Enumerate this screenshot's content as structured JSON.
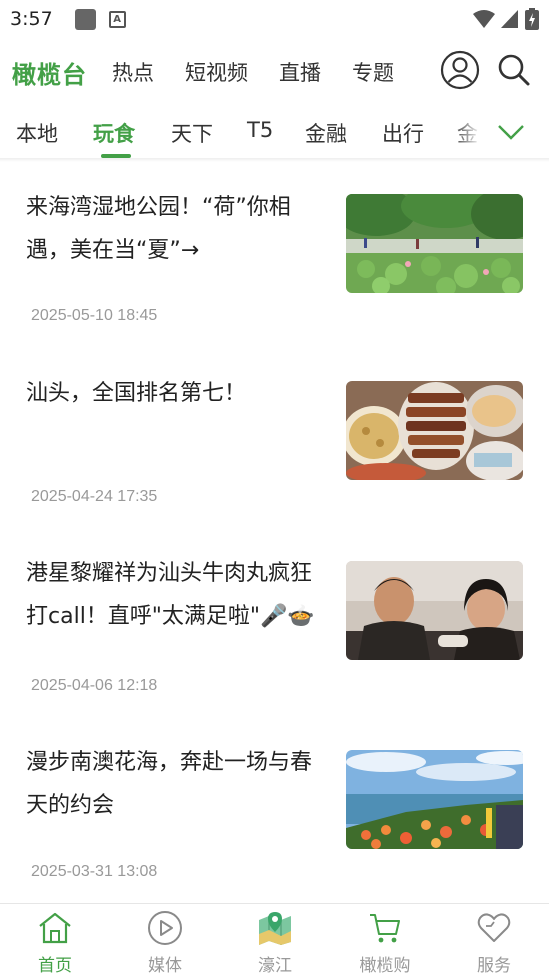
{
  "status_bar": {
    "time": "3:57"
  },
  "header": {
    "logo": "橄榄台",
    "nav": [
      "热点",
      "短视频",
      "直播",
      "专题"
    ]
  },
  "categories": {
    "items": [
      "本地",
      "玩食",
      "天下",
      "T5",
      "金融",
      "出行",
      "金"
    ],
    "active": "玩食"
  },
  "news": [
    {
      "title": "来海湾湿地公园！“荷”你相遇，美在当“夏”→",
      "date": "2025-05-10 18:45"
    },
    {
      "title": "汕头，全国排名第七！",
      "date": "2025-04-24 17:35"
    },
    {
      "title": "港星黎耀祥为汕头牛肉丸疯狂打call！直呼\"太满足啦\"🎤🍲",
      "date": "2025-04-06 12:18"
    },
    {
      "title": "漫步南澳花海，奔赴一场与春天的约会",
      "date": "2025-03-31 13:08"
    }
  ],
  "bottom_nav": [
    "首页",
    "媒体",
    "濠江",
    "橄榄购",
    "服务"
  ],
  "colors": {
    "accent": "#43a047",
    "muted": "#999999"
  }
}
